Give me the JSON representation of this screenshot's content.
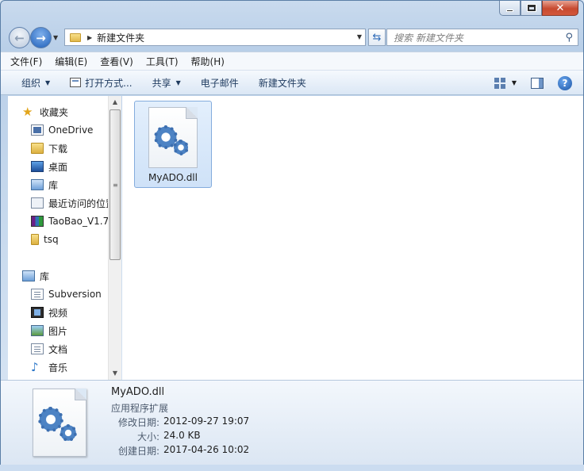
{
  "window": {
    "close_glyph": "✕",
    "maximize_glyph": "",
    "minimize_glyph": ""
  },
  "address": {
    "breadcrumb": "新建文件夹",
    "search_placeholder": "搜索 新建文件夹"
  },
  "menu": [
    "文件(F)",
    "编辑(E)",
    "查看(V)",
    "工具(T)",
    "帮助(H)"
  ],
  "commands": {
    "organize": "组织",
    "open_with": "打开方式...",
    "share": "共享",
    "email": "电子邮件",
    "new_folder": "新建文件夹",
    "help": "?"
  },
  "nav_pane": {
    "favorites": "收藏夹",
    "favorites_items": [
      "OneDrive",
      "下载",
      "桌面",
      "库",
      "最近访问的位置",
      "TaoBao_V1.7",
      "tsq"
    ],
    "libraries": "库",
    "library_items": [
      "Subversion",
      "视频",
      "图片",
      "文档",
      "音乐"
    ]
  },
  "files": [
    {
      "name": "MyADO.dll",
      "icon": "dll-gear-icon",
      "selected": true
    }
  ],
  "details": {
    "name": "MyADO.dll",
    "type": "应用程序扩展",
    "modified_label": "修改日期:",
    "modified_value": "2012-09-27 19:07",
    "size_label": "大小:",
    "size_value": "24.0 KB",
    "created_label": "创建日期:",
    "created_value": "2017-04-26 10:02"
  },
  "colors": {
    "accent": "#2e6bb7",
    "selection": "#cfe2f8",
    "close_button": "#c74a30"
  }
}
